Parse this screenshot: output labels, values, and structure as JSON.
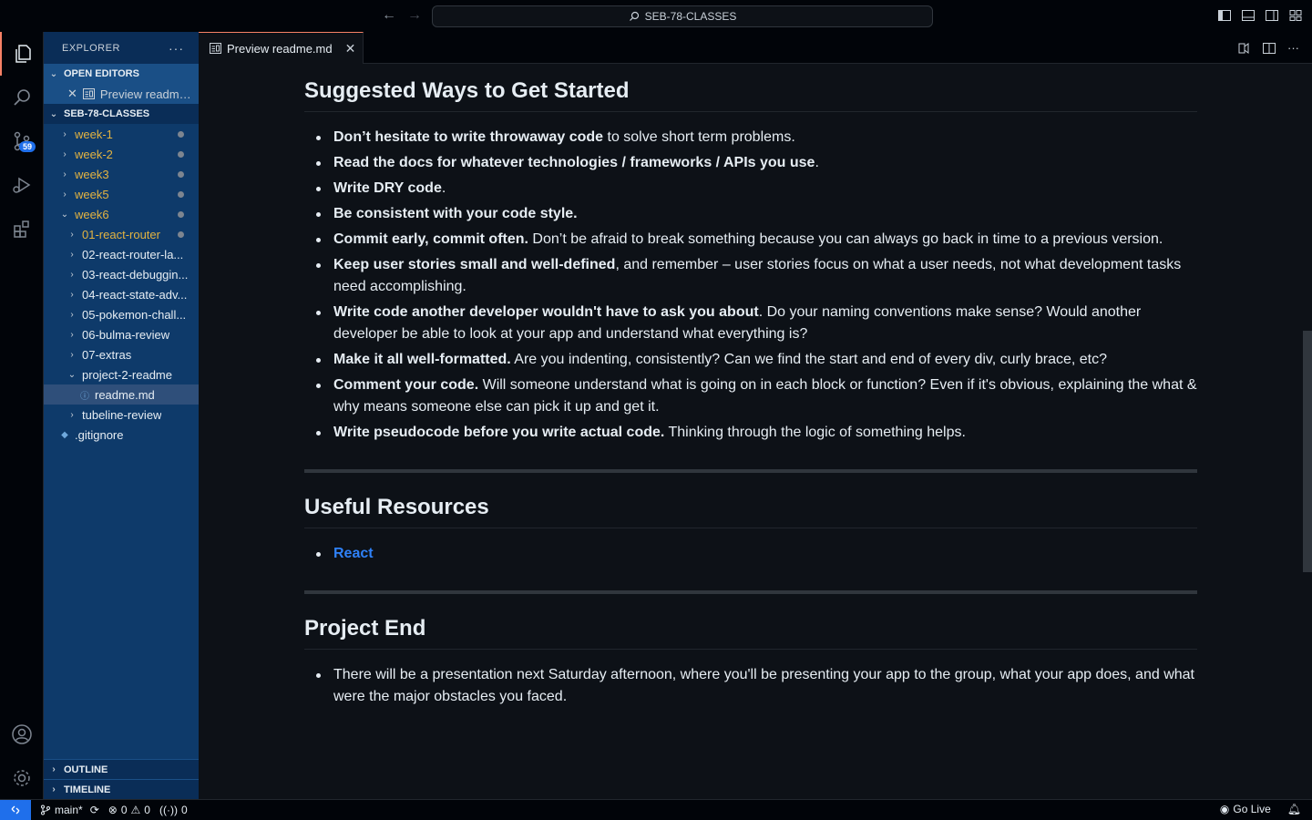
{
  "titlebar": {
    "search": "SEB-78-CLASSES"
  },
  "activity": {
    "scm_badge": "59"
  },
  "sidebar": {
    "title": "EXPLORER",
    "more": "···",
    "open_editors_header": "OPEN EDITORS",
    "open_editor_item": "Preview readme.md",
    "workspace_header": "SEB-78-CLASSES",
    "tree": [
      {
        "label": "week-1",
        "indent": 0,
        "chev": "›",
        "mod": true,
        "dot": true
      },
      {
        "label": "week-2",
        "indent": 0,
        "chev": "›",
        "mod": true,
        "dot": true
      },
      {
        "label": "week3",
        "indent": 0,
        "chev": "›",
        "mod": true,
        "dot": true
      },
      {
        "label": "week5",
        "indent": 0,
        "chev": "›",
        "mod": true,
        "dot": true
      },
      {
        "label": "week6",
        "indent": 0,
        "chev": "⌄",
        "mod": true,
        "dot": true
      },
      {
        "label": "01-react-router",
        "indent": 1,
        "chev": "›",
        "mod": true,
        "dot": true
      },
      {
        "label": "02-react-router-la...",
        "indent": 1,
        "chev": "›",
        "mod": false,
        "dot": false
      },
      {
        "label": "03-react-debuggin...",
        "indent": 1,
        "chev": "›",
        "mod": false,
        "dot": false
      },
      {
        "label": "04-react-state-adv...",
        "indent": 1,
        "chev": "›",
        "mod": false,
        "dot": false
      },
      {
        "label": "05-pokemon-chall...",
        "indent": 1,
        "chev": "›",
        "mod": false,
        "dot": false
      },
      {
        "label": "06-bulma-review",
        "indent": 1,
        "chev": "›",
        "mod": false,
        "dot": false
      },
      {
        "label": "07-extras",
        "indent": 1,
        "chev": "›",
        "mod": false,
        "dot": false
      },
      {
        "label": "project-2-readme",
        "indent": 1,
        "chev": "⌄",
        "mod": false,
        "dot": false
      },
      {
        "label": "readme.md",
        "indent": 2,
        "chev": "",
        "icon": "ⓘ",
        "mod": false,
        "dot": false,
        "selected": true
      },
      {
        "label": "tubeline-review",
        "indent": 1,
        "chev": "›",
        "mod": false,
        "dot": false
      },
      {
        "label": ".gitignore",
        "indent": 0,
        "chev": "",
        "icon": "◆",
        "mod": false,
        "dot": false
      }
    ],
    "outline_header": "OUTLINE",
    "timeline_header": "TIMELINE"
  },
  "tab": {
    "label": "Preview readme.md"
  },
  "doc": {
    "h_suggested": "Suggested Ways to Get Started",
    "suggested": [
      {
        "bold": "Don’t hesitate to write throwaway code",
        "rest": " to solve short term problems."
      },
      {
        "bold": "Read the docs for whatever technologies / frameworks / APIs you use",
        "rest": "."
      },
      {
        "bold": "Write DRY code",
        "rest": "."
      },
      {
        "bold": "Be consistent with your code style.",
        "rest": ""
      },
      {
        "bold": "Commit early, commit often.",
        "rest": " Don’t be afraid to break something because you can always go back in time to a previous version."
      },
      {
        "bold": "Keep user stories small and well-defined",
        "rest": ", and remember – user stories focus on what a user needs, not what development tasks need accomplishing."
      },
      {
        "bold": "Write code another developer wouldn't have to ask you about",
        "rest": ". Do your naming conventions make sense? Would another developer be able to look at your app and understand what everything is?"
      },
      {
        "bold": "Make it all well-formatted.",
        "rest": " Are you indenting, consistently? Can we find the start and end of every div, curly brace, etc?"
      },
      {
        "bold": "Comment your code.",
        "rest": " Will someone understand what is going on in each block or function? Even if it's obvious, explaining the what & why means someone else can pick it up and get it."
      },
      {
        "bold": "Write pseudocode before you write actual code.",
        "rest": " Thinking through the logic of something helps."
      }
    ],
    "h_resources": "Useful Resources",
    "resource_link": "React",
    "h_end": "Project End",
    "end_item": "There will be a presentation next Saturday afternoon, where you'll be presenting your app to the group, what your app does, and what were the major obstacles you faced."
  },
  "status": {
    "branch": "main*",
    "errors": "0",
    "warnings": "0",
    "ports": "0",
    "golive": "Go Live"
  }
}
